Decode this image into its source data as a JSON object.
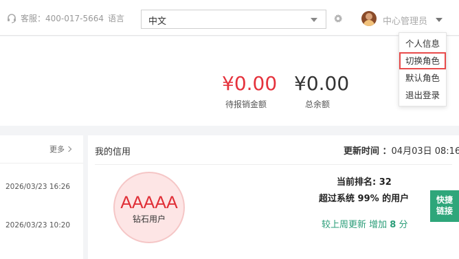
{
  "header": {
    "hotline": "客服：400-017-5664",
    "language_label": "语言",
    "language_value": "中文",
    "user_name": "中心管理员"
  },
  "user_menu": {
    "items": [
      "个人信息",
      "切换角色",
      "默认角色",
      "退出登录"
    ],
    "highlighted": "切换角色",
    "highlight_color": "#e84a4a"
  },
  "balance": {
    "pending_amount": "¥0.00",
    "pending_label": "待报销金额",
    "total_amount": "¥0.00",
    "total_label": "总余额"
  },
  "left_panel": {
    "more_label": "更多",
    "dates": [
      "2026/03/23 16:26",
      "2026/03/23 10:20"
    ]
  },
  "credit": {
    "title": "我的信用",
    "update_label": "更新时间 ：",
    "update_time": "04月03日 08:16",
    "grade": "AAAAA",
    "level": "钻石用户",
    "rank_label": "当前排名: ",
    "rank_value": "32",
    "exceed_prefix": "超过系统 ",
    "exceed_value": "99%",
    "exceed_suffix": " 的用户",
    "weekly_prefix": "较上周更新 增加 ",
    "weekly_value": "8",
    "weekly_suffix": " 分"
  },
  "quick_link": {
    "line1": "快捷",
    "line2": "链接"
  },
  "colors": {
    "accent_red": "#e5323c",
    "accent_green": "#2ea67a"
  },
  "icons": {
    "hotline": "headset-icon",
    "settings": "gear-icon",
    "more": "chevron-right-icon",
    "dropdown": "caret-down-icon"
  }
}
